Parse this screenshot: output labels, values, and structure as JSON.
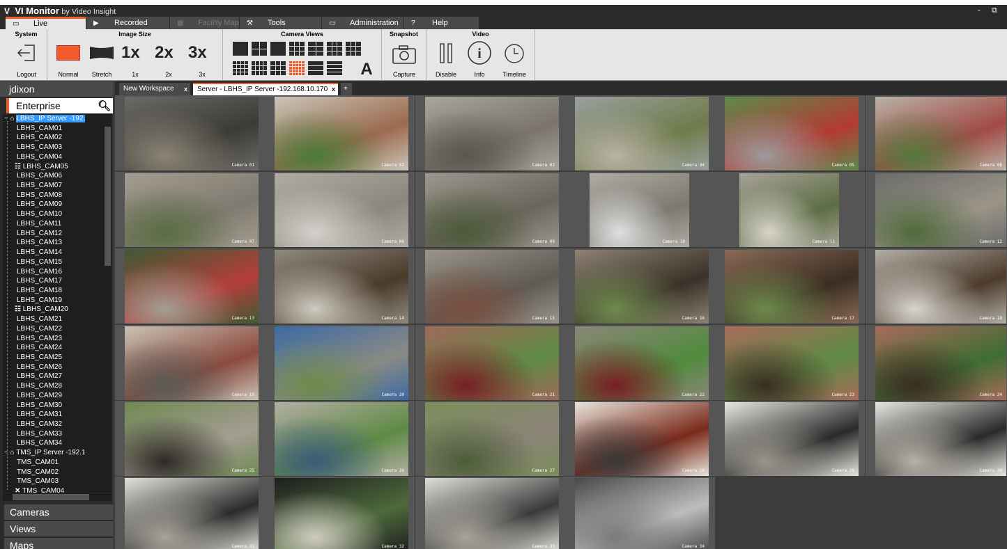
{
  "window": {
    "logo": "V",
    "app_name": "VI Monitor",
    "by_text": "by Video Insight",
    "minimize": "-",
    "restore": "⧉"
  },
  "main_tabs": [
    {
      "label": "Live",
      "icon": "monitor-icon",
      "glyph": "▭",
      "active": true,
      "disabled": false
    },
    {
      "label": "Recorded",
      "icon": "play-icon",
      "glyph": "▶",
      "active": false,
      "disabled": false
    },
    {
      "label": "Facility Map",
      "icon": "building-icon",
      "glyph": "▦",
      "active": false,
      "disabled": true
    },
    {
      "label": "Tools",
      "icon": "tools-icon",
      "glyph": "⚒",
      "active": false,
      "disabled": false
    },
    {
      "label": "Administration",
      "icon": "folder-icon",
      "glyph": "▭",
      "active": false,
      "disabled": false
    },
    {
      "label": "Help",
      "icon": "help-icon",
      "glyph": "?",
      "active": false,
      "disabled": false
    }
  ],
  "ribbon": {
    "system": {
      "title": "System",
      "logout": "Logout"
    },
    "image_size": {
      "title": "Image Size",
      "normal": "Normal",
      "stretch": "Stretch",
      "x1": "1x",
      "x2": "2x",
      "x3": "3x",
      "x1_glyph": "1x",
      "x2_glyph": "2x",
      "x3_glyph": "3x"
    },
    "camera_views": {
      "title": "Camera Views",
      "text_view_glyph": "A",
      "selected_index": 10
    },
    "snapshot": {
      "title": "Snapshot",
      "capture": "Capture"
    },
    "video": {
      "title": "Video",
      "disable": "Disable",
      "info": "Info",
      "timeline": "Timeline"
    }
  },
  "left_panel": {
    "user": "jdixon",
    "enterprise": "Enterprise",
    "tree": [
      {
        "label": "LBHS_IP Server -192.",
        "type": "server",
        "selected": true
      },
      {
        "label": "LBHS_CAM01",
        "type": "cam"
      },
      {
        "label": "LBHS_CAM02",
        "type": "cam"
      },
      {
        "label": "LBHS_CAM03",
        "type": "cam"
      },
      {
        "label": "LBHS_CAM04",
        "type": "cam"
      },
      {
        "label": "LBHS_CAM05",
        "type": "ptz"
      },
      {
        "label": "LBHS_CAM06",
        "type": "cam"
      },
      {
        "label": "LBHS_CAM07",
        "type": "cam"
      },
      {
        "label": "LBHS_CAM08",
        "type": "cam"
      },
      {
        "label": "LBHS_CAM09",
        "type": "cam"
      },
      {
        "label": "LBHS_CAM10",
        "type": "cam"
      },
      {
        "label": "LBHS_CAM11",
        "type": "cam"
      },
      {
        "label": "LBHS_CAM12",
        "type": "cam"
      },
      {
        "label": "LBHS_CAM13",
        "type": "cam"
      },
      {
        "label": "LBHS_CAM14",
        "type": "cam"
      },
      {
        "label": "LBHS_CAM15",
        "type": "cam"
      },
      {
        "label": "LBHS_CAM16",
        "type": "cam"
      },
      {
        "label": "LBHS_CAM17",
        "type": "cam"
      },
      {
        "label": "LBHS_CAM18",
        "type": "cam"
      },
      {
        "label": "LBHS_CAM19",
        "type": "cam"
      },
      {
        "label": "LBHS_CAM20",
        "type": "ptz"
      },
      {
        "label": "LBHS_CAM21",
        "type": "cam"
      },
      {
        "label": "LBHS_CAM22",
        "type": "cam"
      },
      {
        "label": "LBHS_CAM23",
        "type": "cam"
      },
      {
        "label": "LBHS_CAM24",
        "type": "cam"
      },
      {
        "label": "LBHS_CAM25",
        "type": "cam"
      },
      {
        "label": "LBHS_CAM26",
        "type": "cam"
      },
      {
        "label": "LBHS_CAM27",
        "type": "cam"
      },
      {
        "label": "LBHS_CAM28",
        "type": "cam"
      },
      {
        "label": "LBHS_CAM29",
        "type": "cam"
      },
      {
        "label": "LBHS_CAM30",
        "type": "cam"
      },
      {
        "label": "LBHS_CAM31",
        "type": "cam"
      },
      {
        "label": "LBHS_CAM32",
        "type": "cam"
      },
      {
        "label": "LBHS_CAM33",
        "type": "cam"
      },
      {
        "label": "LBHS_CAM34",
        "type": "cam"
      },
      {
        "label": "TMS_IP Server -192.1",
        "type": "server"
      },
      {
        "label": "TMS_CAM01",
        "type": "cam"
      },
      {
        "label": "TMS_CAM02",
        "type": "cam"
      },
      {
        "label": "TMS_CAM03",
        "type": "cam"
      },
      {
        "label": "TMS_CAM04",
        "type": "offline"
      }
    ],
    "accordion": [
      "Cameras",
      "Views",
      "Maps"
    ]
  },
  "workspace_tabs": [
    {
      "label": "New Workspace",
      "close": "x",
      "active": false
    },
    {
      "label": "Server - LBHS_IP Server -192.168.10.170",
      "close": "x",
      "active": true
    },
    {
      "label": "+",
      "close": "",
      "active": false
    }
  ],
  "cameras": [
    {
      "label": "Camera 01",
      "colors": [
        "#6b6a64",
        "#3d3b36",
        "#8c8577"
      ]
    },
    {
      "label": "Camera 02",
      "colors": [
        "#c9c5b8",
        "#9c6a4e",
        "#4c7a3a"
      ]
    },
    {
      "label": "Camera 03",
      "colors": [
        "#aaa59b",
        "#7a746b",
        "#5a5751"
      ]
    },
    {
      "label": "Camera 04",
      "colors": [
        "#9aa0a0",
        "#6f7b4a",
        "#b9b3a6"
      ]
    },
    {
      "label": "Camera 05",
      "colors": [
        "#5d8a4e",
        "#b33a33",
        "#9b9b9b"
      ]
    },
    {
      "label": "Camera 06",
      "colors": [
        "#b9b2a6",
        "#a14a45",
        "#55793e"
      ]
    },
    {
      "label": "Camera 07",
      "colors": [
        "#a49c90",
        "#7f7a70",
        "#5a6d42"
      ]
    },
    {
      "label": "Camera 08",
      "colors": [
        "#b1aca2",
        "#8b877e",
        "#d3d1cb"
      ]
    },
    {
      "label": "Camera 09",
      "colors": [
        "#9c978d",
        "#6b665d",
        "#4d5a3a"
      ]
    },
    {
      "label": "Camera 10",
      "colors": [
        "#b0aca4",
        "#7c7971",
        "#e0e0e0"
      ]
    },
    {
      "label": "Camera 11",
      "colors": [
        "#a8a398",
        "#5c6d44",
        "#d8d4cc"
      ]
    },
    {
      "label": "Camera 12",
      "colors": [
        "#6b6b6b",
        "#9b9488",
        "#4e6a3a"
      ]
    },
    {
      "label": "Camera 13",
      "colors": [
        "#3f5a32",
        "#b43e3a",
        "#a29d92"
      ]
    },
    {
      "label": "Camera 14",
      "colors": [
        "#8f8a80",
        "#4a3a2a",
        "#cfcbc1"
      ]
    },
    {
      "label": "Camera 15",
      "colors": [
        "#9a958a",
        "#5e5b55",
        "#7a4e3e"
      ]
    },
    {
      "label": "Camera 16",
      "colors": [
        "#8e8275",
        "#3b3128",
        "#6d8a4c"
      ]
    },
    {
      "label": "Camera 17",
      "colors": [
        "#8a6a55",
        "#3a2d22",
        "#6d8a4c"
      ]
    },
    {
      "label": "Camera 18",
      "colors": [
        "#b2aea5",
        "#4c3b2c",
        "#d9d6cf"
      ]
    },
    {
      "label": "Camera 19",
      "colors": [
        "#c8c3b6",
        "#8c4a3e",
        "#5b5a55"
      ]
    },
    {
      "label": "Camera 20",
      "colors": [
        "#3b6aa3",
        "#8a8a86",
        "#6d8a4c"
      ]
    },
    {
      "label": "Camera 21",
      "colors": [
        "#a0695a",
        "#5e8a45",
        "#7a1e25"
      ]
    },
    {
      "label": "Camera 22",
      "colors": [
        "#8c8679",
        "#4f8a3c",
        "#7a1e25"
      ]
    },
    {
      "label": "Camera 23",
      "colors": [
        "#a86b5a",
        "#5e8a45",
        "#3a2d22"
      ]
    },
    {
      "label": "Camera 24",
      "colors": [
        "#a86b5a",
        "#3e6d32",
        "#3a2d22"
      ]
    },
    {
      "label": "Camera 25",
      "colors": [
        "#6e8a50",
        "#a49d92",
        "#2d2a25"
      ]
    },
    {
      "label": "Camera 26",
      "colors": [
        "#b4aea3",
        "#5e8a45",
        "#3b5c7a"
      ]
    },
    {
      "label": "Camera 27",
      "colors": [
        "#7b8e5a",
        "#8b8477",
        "#4b5d38"
      ]
    },
    {
      "label": "Camera 28",
      "colors": [
        "#e7e4dc",
        "#7a2a1a",
        "#3a3a3a"
      ]
    },
    {
      "label": "Camera 29",
      "colors": [
        "#e8e6e0",
        "#2a2a2a",
        "#9a968d"
      ]
    },
    {
      "label": "Camera 30",
      "colors": [
        "#e8e6e0",
        "#2a2a2a",
        "#b8b3a8"
      ]
    },
    {
      "label": "Camera 31",
      "colors": [
        "#e3e1da",
        "#2b2b2b",
        "#a8a49b"
      ]
    },
    {
      "label": "Camera 32",
      "colors": [
        "#1e1e1e",
        "#4d6a3b",
        "#cfcbc0"
      ]
    },
    {
      "label": "Camera 33",
      "colors": [
        "#e0ded8",
        "#3a3a3a",
        "#a8a49b"
      ]
    },
    {
      "label": "Camera 34",
      "colors": [
        "#4a4a4a",
        "#bdbdbd",
        "#7a7a7a"
      ]
    }
  ],
  "colors": {
    "accent": "#f15a29",
    "selection": "#3399ff",
    "chrome": "#2b2b2b",
    "ribbon": "#e6e6e6"
  }
}
